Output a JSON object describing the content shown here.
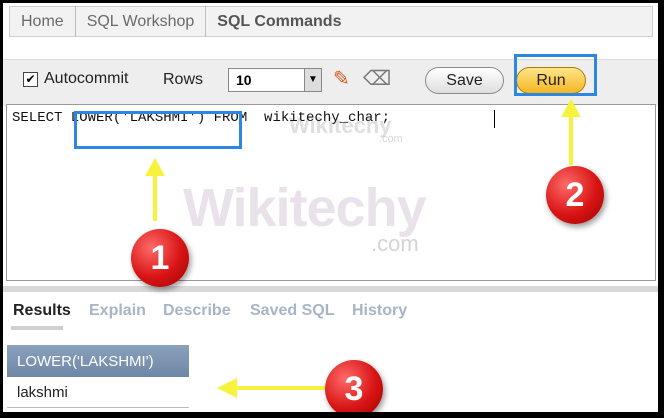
{
  "breadcrumb": {
    "items": [
      "Home",
      "SQL Workshop",
      "SQL Commands"
    ]
  },
  "toolbar": {
    "autocommit_checked": true,
    "autocommit_mark": "✔",
    "autocommit_label": "Autocommit",
    "rows_label": "Rows",
    "rows_value": "10",
    "save_label": "Save",
    "run_label": "Run"
  },
  "editor": {
    "sql": "SELECT LOWER('LAKSHMI') FROM  wikitechy_char;"
  },
  "watermark": {
    "brand": "Wikitechy",
    "domain": ".com"
  },
  "tabs": [
    {
      "label": "Results",
      "active": true
    },
    {
      "label": "Explain",
      "active": false
    },
    {
      "label": "Describe",
      "active": false
    },
    {
      "label": "Saved SQL",
      "active": false
    },
    {
      "label": "History",
      "active": false
    }
  ],
  "results": {
    "columns": [
      "LOWER('LAKSHMI')"
    ],
    "rows": [
      [
        "lakshmi"
      ]
    ]
  },
  "annotations": {
    "callouts": [
      "1",
      "2",
      "3"
    ],
    "highlight_color": "#2b87e0",
    "arrow_color": "#f6f23e",
    "callout_color": "#d81414"
  }
}
